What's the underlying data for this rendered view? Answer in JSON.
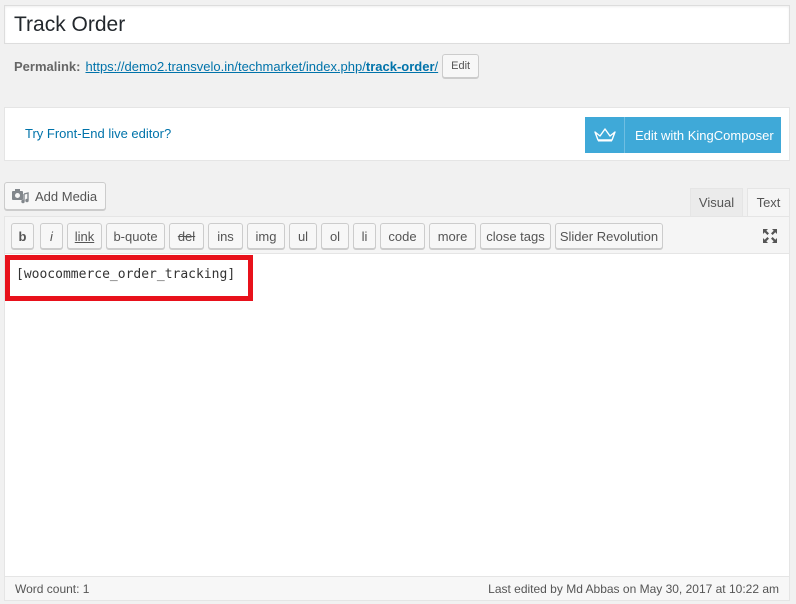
{
  "post": {
    "title": "Track Order"
  },
  "permalink": {
    "label": "Permalink:",
    "url_base": "https://demo2.transvelo.in/techmarket/index.php/",
    "slug": "track-order",
    "trailing": "/",
    "edit_label": "Edit"
  },
  "kingcomposer": {
    "try_link": "Try Front-End live editor?",
    "edit_button": "Edit with KingComposer",
    "color": "#3fa9d8"
  },
  "media": {
    "add_label": "Add Media"
  },
  "tabs": {
    "visual": "Visual",
    "text": "Text"
  },
  "toolbar": {
    "buttons": [
      "b",
      "i",
      "link",
      "b-quote",
      "del",
      "ins",
      "img",
      "ul",
      "ol",
      "li",
      "code",
      "more",
      "close tags",
      "Slider Revolution"
    ]
  },
  "editor": {
    "content": "[woocommerce_order_tracking]",
    "highlight_color": "#e8111b"
  },
  "status": {
    "word_count": "Word count: 1",
    "last_edited": "Last edited by Md Abbas on May 30, 2017 at 10:22 am"
  }
}
